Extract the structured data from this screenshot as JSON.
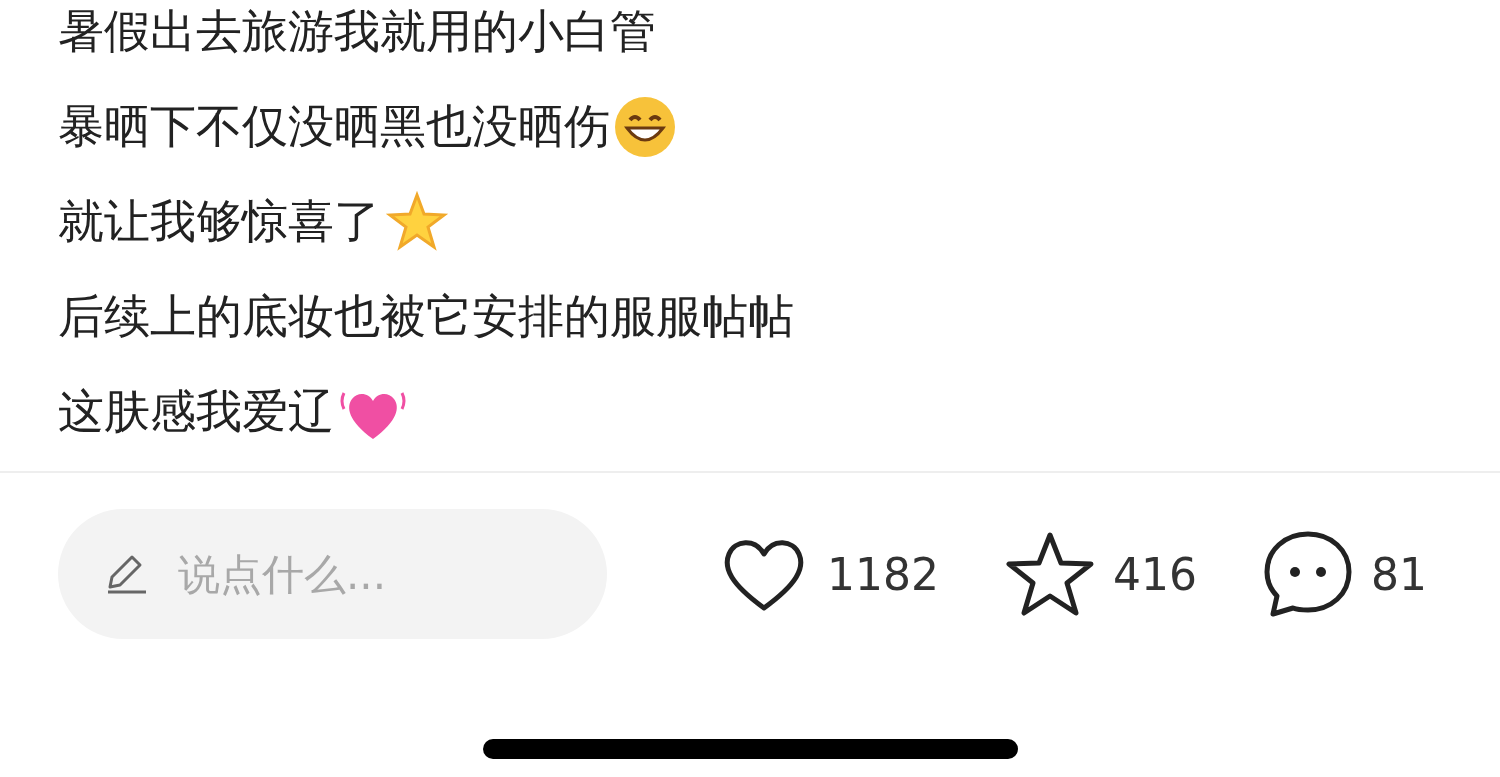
{
  "post": {
    "lines": [
      {
        "kind": "plain",
        "text": "暑假出去旅游我就用的小白管"
      },
      {
        "kind": "grin",
        "text": "暴晒下不仅没晒黑也没晒伤"
      },
      {
        "kind": "star",
        "text": "就让我够惊喜了"
      },
      {
        "kind": "plain",
        "text": "后续上的底妆也被它安排的服服帖帖"
      },
      {
        "kind": "heart",
        "text": "这肤感我爱辽"
      }
    ]
  },
  "bottom_bar": {
    "comment_field": {
      "placeholder": "说点什么..."
    },
    "actions": [
      {
        "kind": "like",
        "count": "1182"
      },
      {
        "kind": "collect",
        "count": "416"
      },
      {
        "kind": "comment",
        "count": "81"
      }
    ]
  }
}
